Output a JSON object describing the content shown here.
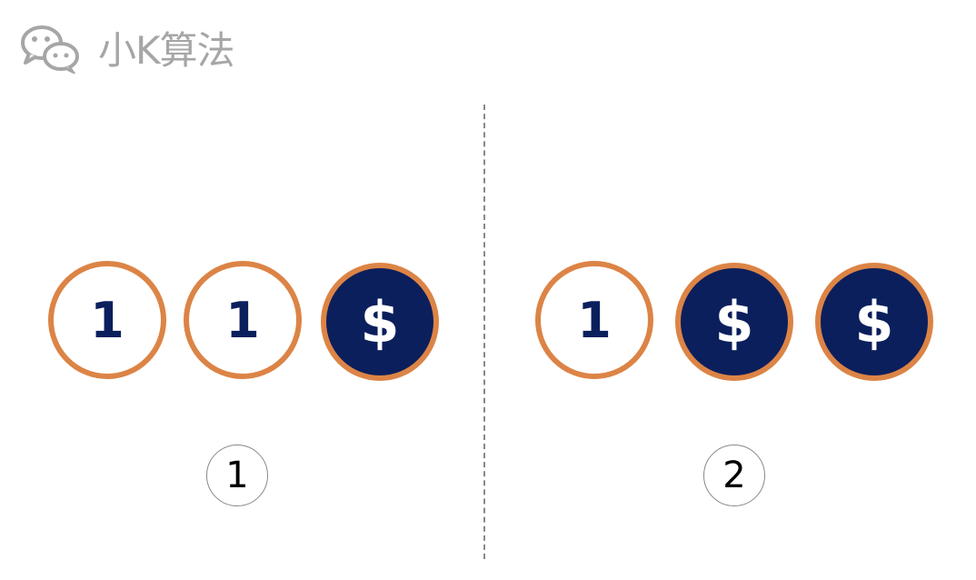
{
  "header": {
    "logo_icon": "wechat-icon",
    "title": "小K算法"
  },
  "groups": [
    {
      "label": "1",
      "coins": [
        "1",
        "1",
        "$"
      ]
    },
    {
      "label": "2",
      "coins": [
        "1",
        "$",
        "$"
      ]
    }
  ],
  "colors": {
    "coin_border": "#dc8446",
    "coin_fill_dark": "#0b1f5c",
    "logo_gray": "#a6a6a6"
  }
}
